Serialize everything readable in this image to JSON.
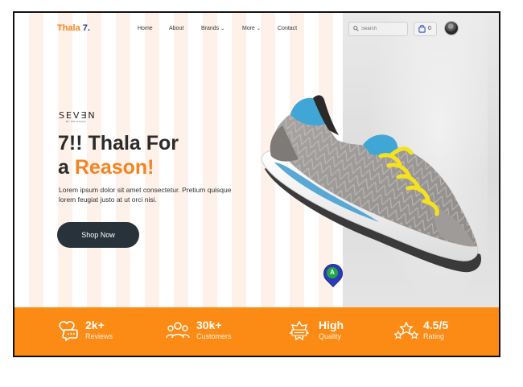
{
  "nav": {
    "logo_text": "Thala",
    "logo_num": "7.",
    "links": [
      {
        "label": "Home"
      },
      {
        "label": "About"
      },
      {
        "label": "Brands",
        "chevron": "⌄"
      },
      {
        "label": "More",
        "chevron": "⌄"
      },
      {
        "label": "Contact"
      }
    ],
    "search_placeholder": "Search",
    "cart_count": "0"
  },
  "hero": {
    "brand_name": "SEV∃N",
    "brand_sub": "BY MS DHONI",
    "headline_line1": "7!! Thala For",
    "headline_a": "a ",
    "headline_highlight": "Reason!",
    "description": "Lorem ipsum dolor sit amet consectetur. Pretium quisque lorem feugiat justo at ut orci nisi.",
    "cta_label": "Shop Now",
    "marker_letter": "A"
  },
  "stats": [
    {
      "value": "2k+",
      "label": "Reviews",
      "icon": "heart-chat-icon"
    },
    {
      "value": "30k+",
      "label": "Customers",
      "icon": "users-icon"
    },
    {
      "value": "High",
      "label": "Quality",
      "icon": "high-quality-badge-icon"
    },
    {
      "value": "4.5/5",
      "label": "Rating",
      "icon": "stars-icon"
    }
  ],
  "colors": {
    "accent": "#f5831f",
    "stats_bar": "#fb8b14",
    "button": "#27323a",
    "logo_number": "#233a8c"
  }
}
